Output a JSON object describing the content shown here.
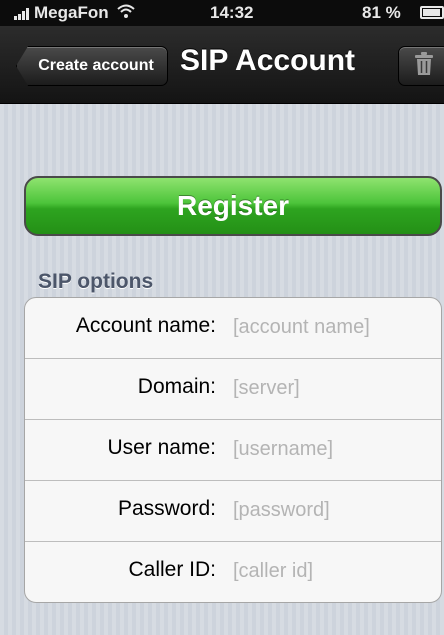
{
  "status_bar": {
    "carrier": "MegaFon",
    "time": "14:32",
    "battery": "81 %"
  },
  "nav_bar": {
    "back_label": "Create account",
    "title": "SIP Account",
    "right_icon": "trash-icon"
  },
  "register": {
    "label": "Register",
    "color": "#3cb72c"
  },
  "section": {
    "title": "SIP options"
  },
  "fields": [
    {
      "label": "Account name:",
      "placeholder": "[account name]",
      "value": ""
    },
    {
      "label": "Domain:",
      "placeholder": "[server]",
      "value": ""
    },
    {
      "label": "User name:",
      "placeholder": "[username]",
      "value": ""
    },
    {
      "label": "Password:",
      "placeholder": "[password]",
      "value": ""
    },
    {
      "label": "Caller ID:",
      "placeholder": "[caller id]",
      "value": ""
    }
  ]
}
